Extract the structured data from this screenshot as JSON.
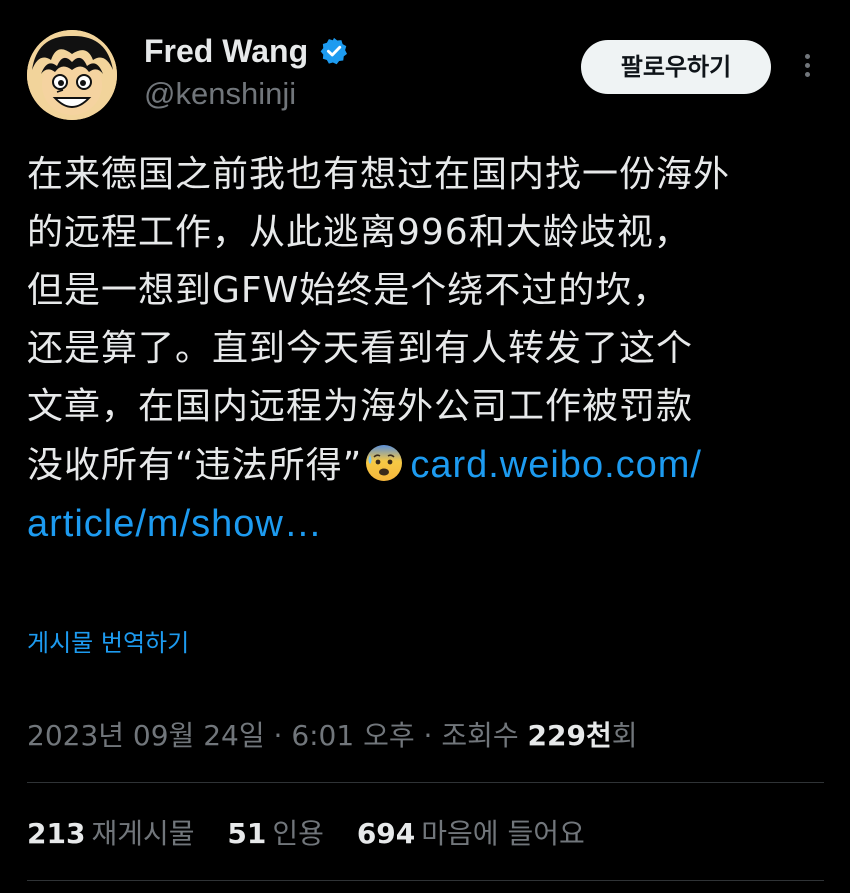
{
  "author": {
    "display_name": "Fred Wang",
    "handle": "@kenshinji",
    "verified_icon": "verified-badge-icon",
    "verified_color": "#1d9bf0"
  },
  "actions": {
    "follow_label": "팔로우하기",
    "more_icon": "more-vertical-icon"
  },
  "tweet": {
    "lines": [
      "在来德国之前我也有想过在国内找一份海外",
      "的远程工作，从此逃离996和大龄歧视，",
      "但是一想到GFW始终是个绕不过的坎，",
      "还是算了。直到今天看到有人转发了这个",
      "文章，在国内远程为海外公司工作被罚款"
    ],
    "last_line_text": "没收所有“违法所得”",
    "emoji": "anxious-face-with-sweat-icon",
    "link_part1": "card.weibo.com/",
    "link_part2": "article/m/show…"
  },
  "translate_label": "게시물 번역하기",
  "meta": {
    "date": "2023년 09월 24일",
    "sep1": " · ",
    "time": "6:01 오후",
    "sep2": " · ",
    "views_label": "조회수 ",
    "views_num": "229천",
    "views_suffix": "회"
  },
  "stats": {
    "reposts_num": "213",
    "reposts_label": "재게시물",
    "quotes_num": "51",
    "quotes_label": "인용",
    "likes_num": "694",
    "likes_label": "마음에 들어요"
  },
  "colors": {
    "background": "#000000",
    "text": "#e7e9ea",
    "secondary": "#71767b",
    "accent": "#1d9bf0",
    "divider": "#2f3336"
  }
}
